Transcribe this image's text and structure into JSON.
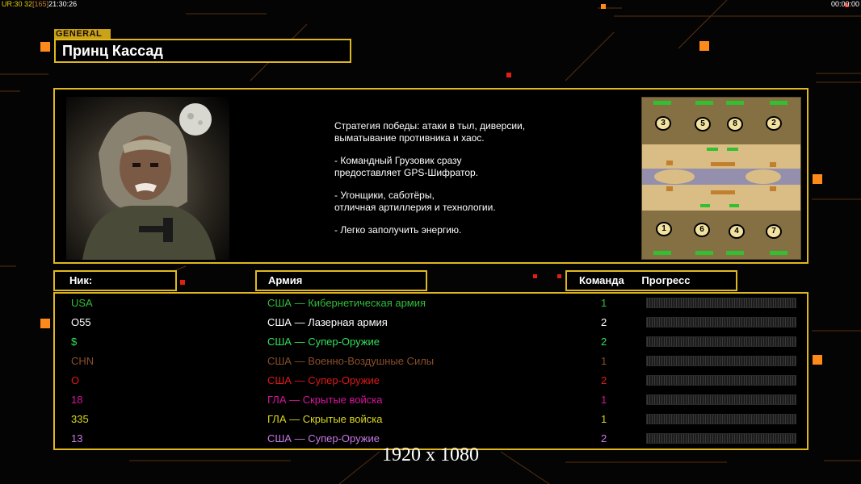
{
  "status": {
    "ur_label": "UR:",
    "ur_value": "30",
    "fps": "32",
    "frame": "[165]",
    "clock": "21:30:26",
    "timer": "00:00:00"
  },
  "general": {
    "tag": "GENERAL",
    "name": "Принц Кассад"
  },
  "description": [
    "Стратегия победы: атаки в тыл, диверсии,\n выматывание противника и хаос.",
    "- Командный Грузовик сразу\nпредоставляет GPS-Шифратор.",
    "- Угонщики, саботёры,\nотличная артиллерия и технологии.",
    "- Легко заполучить энергию."
  ],
  "map": {
    "start_positions": [
      "3",
      "5",
      "8",
      "2",
      "1",
      "6",
      "4",
      "7"
    ]
  },
  "headers": {
    "nick": "Ник:",
    "army": "Армия",
    "team": "Команда",
    "progress": "Прогресс"
  },
  "players": [
    {
      "nick": "USA",
      "army": "США — Кибернетическая армия",
      "team": "1",
      "color": "#2fbf3a"
    },
    {
      "nick": "O55",
      "army": "США — Лазерная армия",
      "team": "2",
      "color": "#ffffff"
    },
    {
      "nick": "$",
      "army": "США — Супер-Оружие",
      "team": "2",
      "color": "#2fe05a"
    },
    {
      "nick": "CHN",
      "army": "США — Военно-Воздушные Силы",
      "team": "1",
      "color": "#8a4f2a"
    },
    {
      "nick": "O",
      "army": "США — Супер-Оружие",
      "team": "2",
      "color": "#e01818"
    },
    {
      "nick": "18",
      "army": "ГЛА — Скрытые войска",
      "team": "1",
      "color": "#d8139c"
    },
    {
      "nick": "335",
      "army": "ГЛА — Скрытые войска",
      "team": "1",
      "color": "#d8d81e"
    },
    {
      "nick": "13",
      "army": "США — Супер-Оружие",
      "team": "2",
      "color": "#c878e8"
    }
  ],
  "resolution_label": "1920 x 1080",
  "colors": {
    "frame": "#e0b81e",
    "accent_orange": "#ff8a1a",
    "accent_red": "#e02010"
  }
}
